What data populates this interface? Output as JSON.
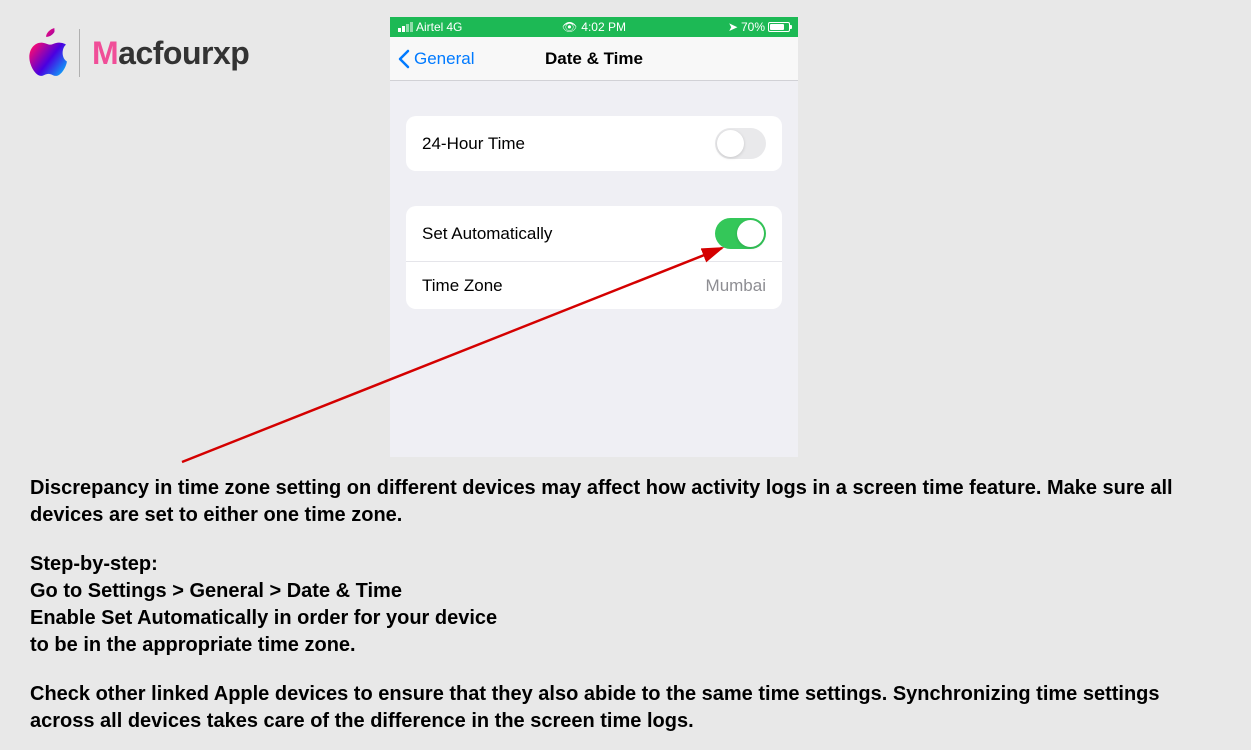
{
  "logo": {
    "brand_first": "M",
    "brand_rest": "acfourxp"
  },
  "status_bar": {
    "carrier": "Airtel",
    "network": "4G",
    "time": "4:02 PM",
    "battery_percent": "70%"
  },
  "nav": {
    "back_label": "General",
    "title": "Date & Time"
  },
  "settings": {
    "group1": {
      "row1_label": "24-Hour Time"
    },
    "group2": {
      "row1_label": "Set Automatically",
      "row2_label": "Time Zone",
      "row2_value": "Mumbai"
    }
  },
  "article": {
    "p1": "Discrepancy in time zone setting on different devices may affect how activity logs in a screen time feature. Make sure all devices are set to either one time zone.",
    "p2_line1": "Step-by-step:",
    "p2_line2": "Go to Settings > General > Date & Time",
    "p2_line3": "Enable Set Automatically in order for your device",
    "p2_line4": "to be in the appropriate time zone.",
    "p3": "Check other linked Apple devices to ensure that they also abide to the same time settings. Synchronizing time settings across all devices takes care of the difference in the screen time logs."
  }
}
